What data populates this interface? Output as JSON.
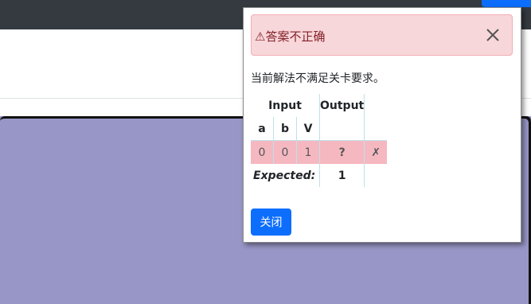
{
  "alert": {
    "title": "⚠答案不正确"
  },
  "message": "当前解法不满足关卡要求。",
  "table": {
    "group_headers": {
      "input": "Input",
      "output": "Output"
    },
    "columns": [
      "a",
      "b",
      "V"
    ],
    "row": {
      "a": "0",
      "b": "0",
      "v": "1",
      "output": "?",
      "status": "✗"
    },
    "expected_label": "Expected:",
    "expected_value": "1"
  },
  "buttons": {
    "close": "关闭"
  },
  "colors": {
    "alert_bg": "#f8d7da",
    "row_error_bg": "#f5b8c1",
    "primary": "#0d6efd",
    "background": "#9896c6"
  }
}
